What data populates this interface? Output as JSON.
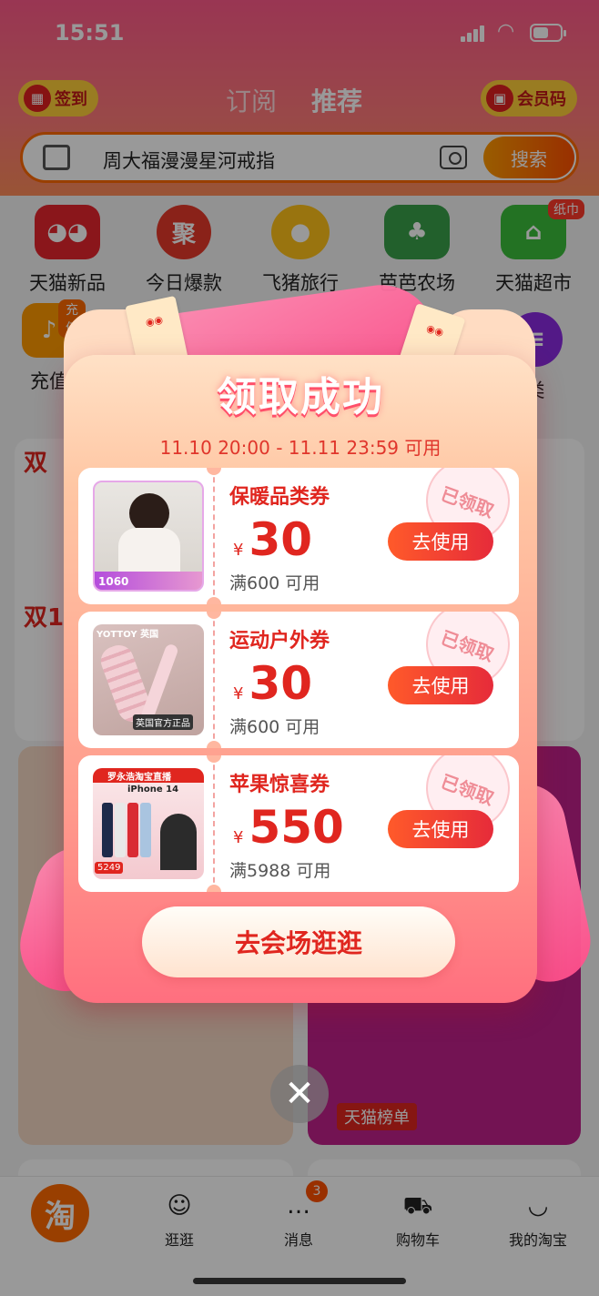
{
  "status_bar": {
    "time": "15:51"
  },
  "header": {
    "signin_label": "签到",
    "tabs": [
      {
        "label": "订阅"
      },
      {
        "label": "推荐"
      }
    ],
    "member_label": "会员码",
    "search": {
      "query": "周大福漫漫星河戒指",
      "button_label": "搜索"
    }
  },
  "shortcuts": [
    {
      "label": "天猫新品",
      "icon": "tmall-icon",
      "color": "#e6262e"
    },
    {
      "label": "今日爆款",
      "icon": "flame-icon",
      "color": "#e63a2b"
    },
    {
      "label": "飞猪旅行",
      "icon": "pig-icon",
      "color": "#ffc21a"
    },
    {
      "label": "芭芭农场",
      "icon": "tree-icon",
      "color": "#3aa04a"
    },
    {
      "label": "天猫超市",
      "icon": "store-icon",
      "color": "#3bbf3b",
      "badge": "纸巾"
    }
  ],
  "shortcuts_row2": [
    {
      "label": "充值",
      "badge": "充值"
    },
    {
      "label": "类"
    }
  ],
  "background_labels": {
    "double11_a": "双",
    "double11_b": "双1",
    "rank_label": "天猫榜单"
  },
  "modal": {
    "title": "领取成功",
    "valid_time": "11.10 20:00 - 11.11 23:59 可用",
    "coupons": [
      {
        "name": "保暖品类券",
        "currency": "¥",
        "amount": "30",
        "condition": "满600 可用",
        "button": "去使用",
        "stamp": "已领取",
        "thumb_icon": "jacket-product-image",
        "thumb_price": "1060"
      },
      {
        "name": "运动户外券",
        "currency": "¥",
        "amount": "30",
        "condition": "满600 可用",
        "button": "去使用",
        "stamp": "已领取",
        "thumb_icon": "foam-roller-product-image",
        "thumb_brand": "YOTTOY 英国",
        "thumb_tag": "英国官方正品"
      },
      {
        "name": "苹果惊喜券",
        "currency": "¥",
        "amount": "550",
        "condition": "满5988 可用",
        "button": "去使用",
        "stamp": "已领取",
        "thumb_icon": "iphone-product-image",
        "thumb_banner": "罗永浩淘宝直播",
        "thumb_model": "iPhone 14",
        "thumb_price": "5249"
      }
    ],
    "venue_button": "去会场逛逛"
  },
  "tab_bar": [
    {
      "label": "淘",
      "icon": "taobao-home-icon"
    },
    {
      "label": "逛逛",
      "icon": "stroll-icon"
    },
    {
      "label": "消息",
      "icon": "message-icon",
      "badge": "3"
    },
    {
      "label": "购物车",
      "icon": "cart-icon"
    },
    {
      "label": "我的淘宝",
      "icon": "profile-icon"
    }
  ]
}
